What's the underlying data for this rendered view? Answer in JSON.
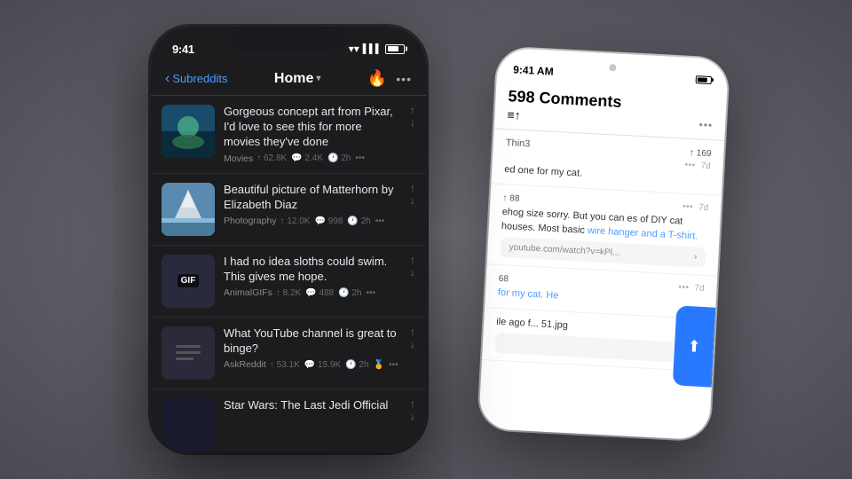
{
  "background": "#6b6b72",
  "phones": {
    "dark_phone": {
      "status_time": "9:41",
      "nav": {
        "back_label": "Subreddits",
        "title": "Home",
        "title_chevron": "▾"
      },
      "posts": [
        {
          "id": "post-1",
          "title": "Gorgeous concept art from Pixar, I'd love to see this for more movies they've done",
          "subreddit": "Movies",
          "upvotes": "62.8K",
          "comments": "2.4K",
          "time": "2h",
          "thumb_type": "pixar"
        },
        {
          "id": "post-2",
          "title": "Beautiful picture of Matterhorn by Elizabeth Diaz",
          "subreddit": "Photography",
          "upvotes": "12.0K",
          "comments": "998",
          "time": "2h",
          "thumb_type": "matterhorn"
        },
        {
          "id": "post-3",
          "title": "I had no idea sloths could swim. This gives me hope.",
          "subreddit": "AnimalGIFs",
          "upvotes": "8.2K",
          "comments": "488",
          "time": "2h",
          "thumb_type": "gif"
        },
        {
          "id": "post-4",
          "title": "What YouTube channel is great to binge?",
          "subreddit": "AskReddit",
          "upvotes": "53.1K",
          "comments": "15.9K",
          "time": "2h",
          "award": "🏅",
          "thumb_type": "reddit"
        },
        {
          "id": "post-5",
          "title": "Star Wars: The Last Jedi Official",
          "subreddit": "",
          "upvotes": "",
          "comments": "",
          "time": "",
          "thumb_type": "starwars"
        }
      ]
    },
    "white_phone": {
      "status_time": "9:41 AM",
      "comments_count": "598 Comments",
      "comments": [
        {
          "partial_author": "Thin3",
          "upvotes": "↑ 169",
          "dots": "•••",
          "age": "7d",
          "partial_body": "ed one for my cat."
        },
        {
          "partial_author": "",
          "upvotes": "↑ 88",
          "dots": "•••",
          "age": "7d",
          "partial_body": "ehog size sorry. But you can\nes of DIY cat houses. Most basic",
          "link_text": "wire hanger and a T-shirt.",
          "link_url": "youtube.com/watch?v=kPl..."
        },
        {
          "partial_author": "",
          "upvotes": "68",
          "dots": "•••",
          "age": "7d",
          "partial_body": "for my cat. He"
        },
        {
          "partial_author": "",
          "upvotes": "",
          "dots": "",
          "age": "",
          "partial_body": "ile ago f...\n51.jpg",
          "link_url": ""
        }
      ],
      "scroll_to_top_label": "⬆"
    }
  }
}
